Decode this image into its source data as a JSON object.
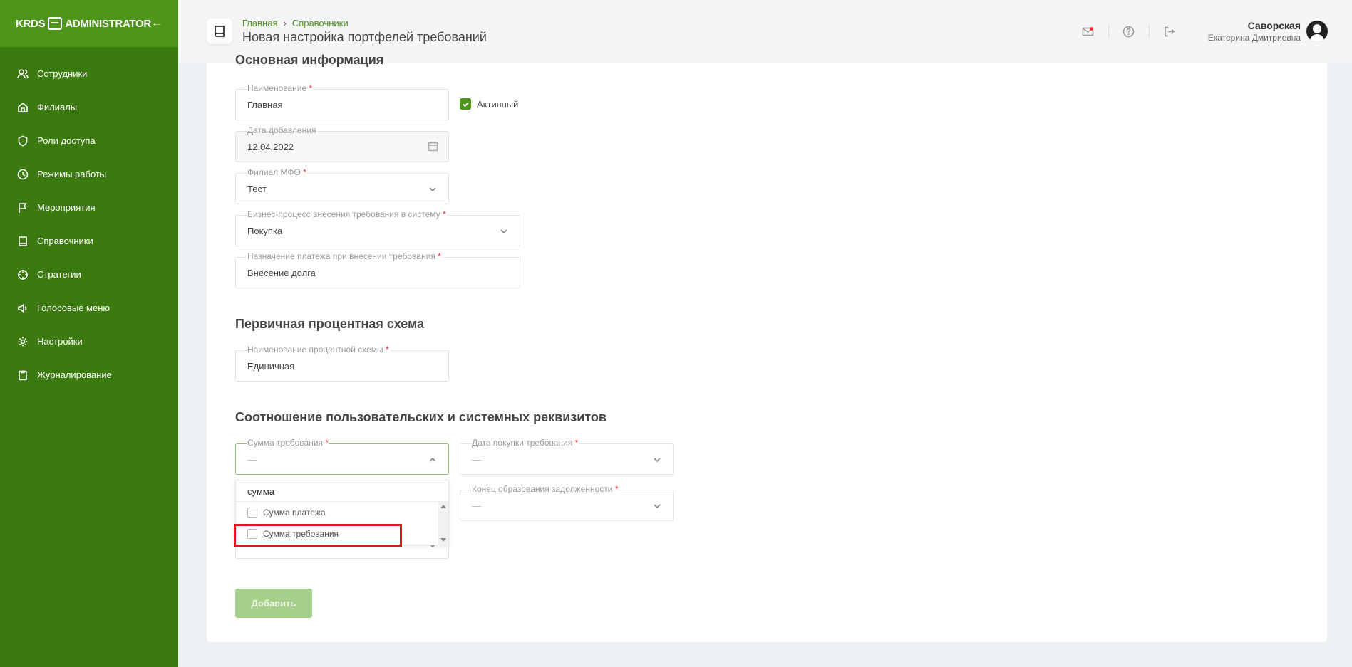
{
  "sidebar": {
    "logo": "KRDS",
    "logo_suffix": "ADMINISTRATOR",
    "items": [
      {
        "label": "Сотрудники",
        "icon": "users-icon"
      },
      {
        "label": "Филиалы",
        "icon": "home-icon"
      },
      {
        "label": "Роли доступа",
        "icon": "shield-icon"
      },
      {
        "label": "Режимы работы",
        "icon": "clock-icon"
      },
      {
        "label": "Мероприятия",
        "icon": "flag-icon"
      },
      {
        "label": "Справочники",
        "icon": "book-icon"
      },
      {
        "label": "Стратегии",
        "icon": "crosshair-icon"
      },
      {
        "label": "Голосовые меню",
        "icon": "speaker-icon"
      },
      {
        "label": "Настройки",
        "icon": "gear-icon"
      },
      {
        "label": "Журналирование",
        "icon": "clipboard-icon"
      }
    ]
  },
  "header": {
    "breadcrumb": [
      "Главная",
      "Справочники"
    ],
    "breadcrumb_sep": "›",
    "title": "Новая настройка портфелей требований",
    "user_name": "Саворская",
    "user_sub": "Екатерина Дмитриевна"
  },
  "sections": {
    "main_info": "Основная информация",
    "interest": "Первичная процентная схема",
    "mapping": "Соотношение пользовательских и системных реквизитов"
  },
  "fields": {
    "name": {
      "label": "Наименование",
      "value": "Главная"
    },
    "active": {
      "label": "Активный",
      "checked": true
    },
    "date_added": {
      "label": "Дата добавления",
      "value": "12.04.2022"
    },
    "branch": {
      "label": "Филиал МФО",
      "value": "Тест"
    },
    "business_process": {
      "label": "Бизнес-процесс внесения требования в систему",
      "value": "Покупка"
    },
    "payment_purpose": {
      "label": "Назначение платежа при внесении требования",
      "value": "Внесение долга"
    },
    "scheme_name": {
      "label": "Наименование процентной схемы",
      "value": "Единичная"
    },
    "claim_sum": {
      "label": "Сумма требования",
      "value": "—"
    },
    "purchase_date": {
      "label": "Дата покупки требования",
      "value": "—"
    },
    "debt_end": {
      "label": "Конец образования задолженности",
      "value": "—"
    },
    "hidden_field": {
      "value": "—"
    }
  },
  "dropdown": {
    "search": "сумма",
    "options": [
      "Сумма платежа",
      "Сумма требования"
    ]
  },
  "required_mark": "*",
  "add_button": "Добавить",
  "colors": {
    "sidebar": "#3b7a0e",
    "sidebar_top": "#4e9619",
    "accent": "#4e9619",
    "highlight": "#e0141e"
  }
}
